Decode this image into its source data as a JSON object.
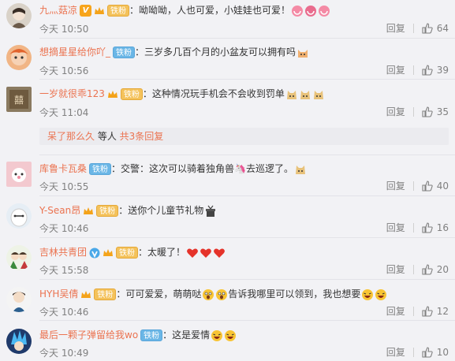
{
  "comments": [
    {
      "user": "九灬菇凉",
      "badge": "铁粉",
      "text": "：呦呦呦，人也可爱，小娃娃也可爱！",
      "time": "今天 10:50",
      "reply": "回复",
      "likes": "64"
    },
    {
      "user": "想摘星星给你吖_",
      "badge": "铁粉",
      "text": "：三岁多几百个月的小盆友可以拥有吗",
      "time": "今天 10:56",
      "reply": "回复",
      "likes": "39"
    },
    {
      "user": "一岁就很乖123",
      "badge": "铁粉",
      "text": "：这种情况玩手机会不会收到罚单",
      "time": "今天 11:04",
      "reply": "回复",
      "likes": "35"
    },
    {
      "user": "库鲁卡瓦桑",
      "badge": "铁粉",
      "text": "：交警：这次可以骑着独角兽🦄去巡逻了。",
      "time": "今天 10:55",
      "reply": "回复",
      "likes": "40"
    },
    {
      "user": "Y-Sean昂",
      "badge": "铁粉",
      "text": "：送你个儿童节礼物",
      "time": "今天 10:46",
      "reply": "回复",
      "likes": "16"
    },
    {
      "user": "吉林共青团",
      "badge": "铁粉",
      "text": "：太暖了！",
      "time": "今天 15:58",
      "reply": "回复",
      "likes": "20"
    },
    {
      "user": "HYH吴倩",
      "badge": "铁粉",
      "text": "：可可爱爱，萌萌哒",
      "text2": "告诉我哪里可以领到，我也想要",
      "time": "今天 10:46",
      "reply": "回复",
      "likes": "12"
    },
    {
      "user": "最后一颗子弹留给我wo",
      "badge": "铁粉",
      "text": "：这是爱情",
      "time": "今天 10:49",
      "reply": "回复",
      "likes": "10"
    }
  ],
  "subreply": {
    "waited": "呆了那么久",
    "others": " 等人 ",
    "total": "共3条回复"
  },
  "colors": {
    "link": "#eb7350",
    "meta": "#808080",
    "background": "#f2f2f5",
    "fan_badge": "#6ab6e6"
  }
}
